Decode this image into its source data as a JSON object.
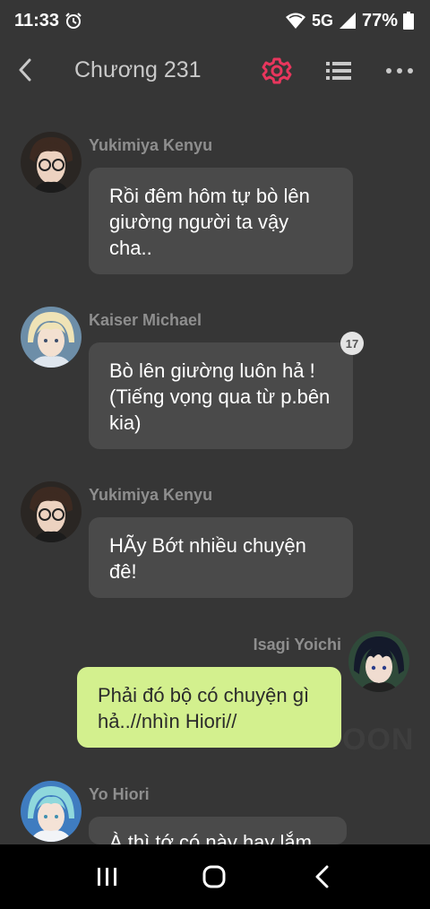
{
  "status_bar": {
    "time": "11:33",
    "network": "5G",
    "battery": "77%"
  },
  "header": {
    "title": "Chương 231"
  },
  "messages": [
    {
      "sender": "Yukimiya Kenyu",
      "text": "Rồi đêm hôm tự bò lên giường người ta vậy cha.."
    },
    {
      "sender": "Kaiser Michael",
      "text": "Bò lên giường luôn hả ! (Tiếng vọng qua từ p.bên kia)",
      "badge": "17"
    },
    {
      "sender": "Yukimiya Kenyu",
      "text": "HÃy Bớt nhiều chuyện đê!"
    },
    {
      "sender": "Isagi Yoichi",
      "text": "Phải đó bộ có chuyện gì hả..//nhìn Hiori//"
    },
    {
      "sender": "Yo Hiori",
      "text": "À thì tớ có này hay lắm"
    }
  ],
  "colors": {
    "background": "#363636",
    "bubble": "#4a4a4a",
    "own_bubble": "#d3f08e",
    "accent": "#e8365d"
  },
  "icons": [
    "alarm-icon",
    "wifi-icon",
    "signal-icon",
    "battery-icon",
    "back-icon",
    "gear-icon",
    "list-icon",
    "more-icon",
    "recents-icon",
    "home-icon",
    "nav-back-icon"
  ]
}
